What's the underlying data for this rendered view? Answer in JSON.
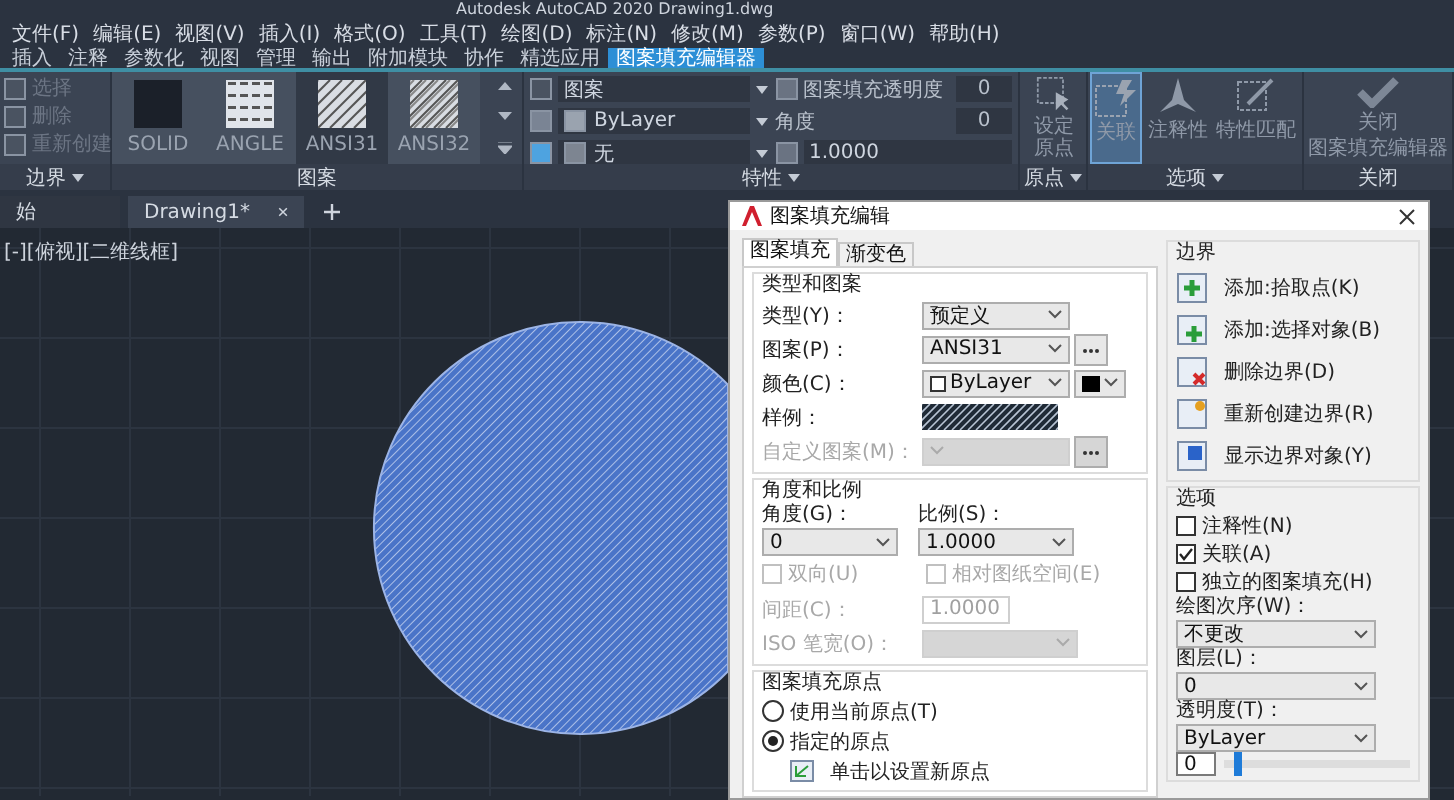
{
  "title_bar": {
    "title": "Autodesk AutoCAD 2020    Drawing1.dwg"
  },
  "menu": [
    "文件(F)",
    "编辑(E)",
    "视图(V)",
    "插入(I)",
    "格式(O)",
    "工具(T)",
    "绘图(D)",
    "标注(N)",
    "修改(M)",
    "参数(P)",
    "窗口(W)",
    "帮助(H)"
  ],
  "ribbon_tabs": [
    {
      "label": "插入",
      "selected": false
    },
    {
      "label": "注释",
      "selected": false
    },
    {
      "label": "参数化",
      "selected": false
    },
    {
      "label": "视图",
      "selected": false
    },
    {
      "label": "管理",
      "selected": false
    },
    {
      "label": "输出",
      "selected": false
    },
    {
      "label": "附加模块",
      "selected": false
    },
    {
      "label": "协作",
      "selected": false
    },
    {
      "label": "精选应用",
      "selected": false
    },
    {
      "label": "图案填充编辑器",
      "selected": true
    }
  ],
  "ribbon": {
    "boundary": {
      "label": "边界",
      "items": [
        {
          "label": "选择",
          "disabled": true
        },
        {
          "label": "删除",
          "disabled": true
        },
        {
          "label": "重新创建",
          "disabled": true
        }
      ]
    },
    "pattern": {
      "label": "图案",
      "swatches": [
        {
          "kind": "solid",
          "label": "SOLID",
          "selected": false
        },
        {
          "kind": "angle",
          "label": "ANGLE",
          "selected": false
        },
        {
          "kind": "ansi31",
          "label": "ANSI31",
          "selected": true
        },
        {
          "kind": "ansi32",
          "label": "ANSI32",
          "selected": false
        }
      ]
    },
    "properties": {
      "label": "特性",
      "pattern_type": "图案",
      "color_setting": "ByLayer",
      "background": "无",
      "transparency_label": "图案填充透明度",
      "transparency": "0",
      "angle_label": "角度",
      "angle": "0",
      "scale": "1.0000"
    },
    "origin": {
      "label": "原点",
      "button": "设定原点"
    },
    "options": {
      "label": "选项",
      "buttons": [
        {
          "kind": "associative",
          "label": "关联",
          "selected": true
        },
        {
          "kind": "annotative",
          "label": "注释性",
          "selected": false
        },
        {
          "kind": "match",
          "label": "特性匹配",
          "selected": false
        }
      ]
    },
    "close": {
      "label": "关闭",
      "button_lines": [
        "关闭",
        "图案填充编辑器"
      ]
    }
  },
  "doc_tabs": [
    {
      "label": "始",
      "selected": false
    },
    {
      "label": "Drawing1*",
      "selected": true
    }
  ],
  "viewport_label": "[-][俯视][二维线框]",
  "dialog": {
    "title": "图案填充编辑",
    "tabs": [
      {
        "label": "图案填充",
        "selected": true
      },
      {
        "label": "渐变色",
        "selected": false
      }
    ],
    "type_group": {
      "title": "类型和图案",
      "rows": [
        {
          "kind": "select",
          "label": "类型(Y)：",
          "value": "预定义",
          "disabled": false
        },
        {
          "kind": "select_more",
          "label": "图案(P)：",
          "value": "ANSI31",
          "disabled": false
        },
        {
          "kind": "color",
          "label": "颜色(C)：",
          "value": "ByLayer",
          "disabled": false
        },
        {
          "kind": "sample",
          "label": "样例：",
          "disabled": false
        },
        {
          "kind": "select_more",
          "label": "自定义图案(M)：",
          "disabled": true
        }
      ]
    },
    "angle_group": {
      "title": "角度和比例",
      "fields": [
        {
          "label": "角度(G)：",
          "value": "0"
        },
        {
          "label": "比例(S)：",
          "value": "1.0000"
        }
      ],
      "checkboxes": [
        {
          "label": "双向(U)",
          "checked": false,
          "disabled": true
        },
        {
          "label": "相对图纸空间(E)",
          "checked": false,
          "disabled": true
        }
      ],
      "rows": [
        {
          "kind": "input",
          "label": "间距(C)：",
          "value": "1.0000",
          "disabled": true
        },
        {
          "kind": "select",
          "label": "ISO 笔宽(O)：",
          "disabled": true
        }
      ]
    },
    "origin_group": {
      "title": "图案填充原点",
      "radios": [
        {
          "label": "使用当前原点(T)",
          "selected": false
        },
        {
          "label": "指定的原点",
          "selected": true
        }
      ],
      "button": "单击以设置新原点"
    },
    "boundary_group": {
      "title": "边界",
      "buttons": [
        {
          "kind": "pick",
          "label": "添加:拾取点(K)"
        },
        {
          "kind": "select",
          "label": "添加:选择对象(B)"
        },
        {
          "kind": "remove",
          "label": "删除边界(D)"
        },
        {
          "kind": "recreate",
          "label": "重新创建边界(R)"
        },
        {
          "kind": "show",
          "label": "显示边界对象(Y)"
        }
      ]
    },
    "options_group": {
      "title": "选项",
      "checkboxes": [
        {
          "label": "注释性(N)",
          "checked": false
        },
        {
          "label": "关联(A)",
          "checked": true
        },
        {
          "label": "独立的图案填充(H)",
          "checked": false
        }
      ],
      "selects": [
        {
          "label": "绘图次序(W)：",
          "value": "不更改"
        },
        {
          "label": "图层(L)：",
          "value": "0"
        },
        {
          "label": "透明度(T)：",
          "value": "ByLayer"
        }
      ],
      "transparency": {
        "value": "0",
        "level": 0.05
      }
    }
  }
}
